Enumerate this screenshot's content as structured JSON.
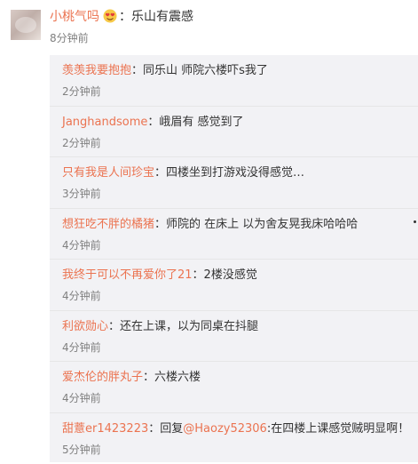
{
  "top_comment": {
    "username": "小桃气吗",
    "emoji_name": "heart-eyes-emoji",
    "separator": "：",
    "text": "乐山有震感",
    "time": "8分钟前"
  },
  "replies": [
    {
      "username": "羡羡我要抱抱",
      "text": "：同乐山 师院六楼吓s我了",
      "time": "2分钟前"
    },
    {
      "username": "Janghandsome",
      "text": "：峨眉有  感觉到了",
      "time": "2分钟前"
    },
    {
      "username": "只有我是人间珍宝",
      "text": "：四楼坐到打游戏没得感觉…",
      "time": "3分钟前"
    },
    {
      "username": "想狂吃不胖的橘猪",
      "text": "：师院的 在床上 以为舍友晃我床哈哈哈",
      "time": "4分钟前"
    },
    {
      "username": "我终于可以不再爱你了21",
      "text": "：2楼没感觉",
      "time": "4分钟前"
    },
    {
      "username": "利欲勋心",
      "text": "：还在上课，以为同桌在抖腿",
      "time": "4分钟前"
    },
    {
      "username": "爱杰伦的胖丸子",
      "text": "：六楼六楼",
      "time": "4分钟前"
    },
    {
      "username": "甜薏er1423223",
      "text_before": "：回复",
      "mention": "@Haozy52306",
      "text_after": ":在四楼上课感觉贼明显啊！",
      "time": "5分钟前"
    }
  ],
  "colors": {
    "username": "#eb7350",
    "time": "#808080",
    "reply_bg": "#f2f2f5"
  }
}
